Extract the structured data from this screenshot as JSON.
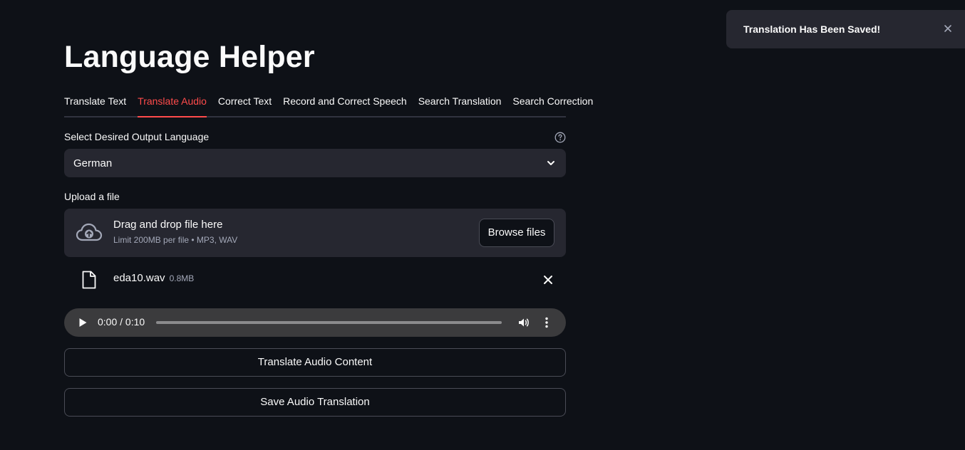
{
  "app": {
    "title": "Language Helper"
  },
  "tabs": [
    {
      "label": "Translate Text",
      "active": false
    },
    {
      "label": "Translate Audio",
      "active": true
    },
    {
      "label": "Correct Text",
      "active": false
    },
    {
      "label": "Record and Correct Speech",
      "active": false
    },
    {
      "label": "Search Translation",
      "active": false
    },
    {
      "label": "Search Correction",
      "active": false
    }
  ],
  "language_select": {
    "label": "Select Desired Output Language",
    "value": "German",
    "help_icon": "question-circle-icon"
  },
  "uploader": {
    "label": "Upload a file",
    "drop_title": "Drag and drop file here",
    "drop_subtitle": "Limit 200MB per file • MP3, WAV",
    "browse_label": "Browse files",
    "icon": "cloud-upload-icon"
  },
  "uploaded_file": {
    "name": "eda10.wav",
    "size": "0.8MB"
  },
  "audio_player": {
    "time": "0:00 / 0:10",
    "progress": 0.0
  },
  "buttons": {
    "translate_label": "Translate Audio Content",
    "save_label": "Save Audio Translation"
  },
  "toast": {
    "message": "Translation Has Been Saved!"
  },
  "colors": {
    "background": "#0e1117",
    "surface": "#262730",
    "accent": "#ff4b4b",
    "text": "#fafafa",
    "muted": "#a3a8b8"
  }
}
